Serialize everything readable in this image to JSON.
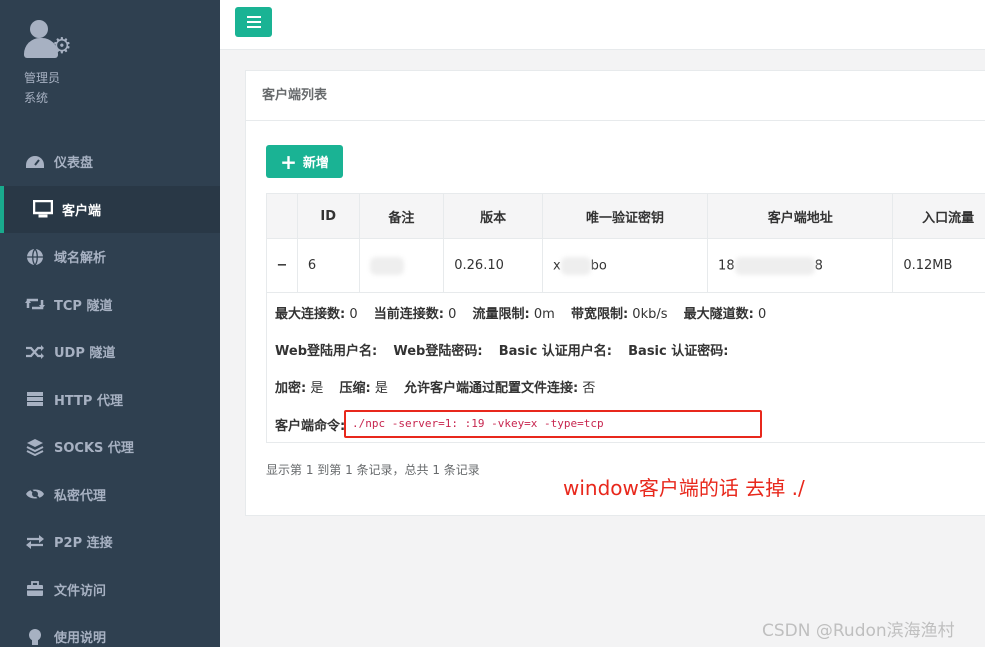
{
  "sidebar": {
    "user": {
      "name": "管理员",
      "role": "系统"
    },
    "items": [
      {
        "label": "仪表盘",
        "icon": "dashboard-icon"
      },
      {
        "label": "客户端",
        "icon": "desktop-icon",
        "active": true
      },
      {
        "label": "域名解析",
        "icon": "globe-icon"
      },
      {
        "label": "TCP 隧道",
        "icon": "retweet-icon"
      },
      {
        "label": "UDP 隧道",
        "icon": "random-icon"
      },
      {
        "label": "HTTP 代理",
        "icon": "server-icon"
      },
      {
        "label": "SOCKS 代理",
        "icon": "layers-icon"
      },
      {
        "label": "私密代理",
        "icon": "eye-slash-icon"
      },
      {
        "label": "P2P 连接",
        "icon": "exchange-icon"
      },
      {
        "label": "文件访问",
        "icon": "briefcase-icon"
      },
      {
        "label": "使用说明",
        "icon": "lightbulb-icon"
      }
    ]
  },
  "panel": {
    "title": "客户端列表",
    "add_button": "新增",
    "table": {
      "headers": [
        "ID",
        "备注",
        "版本",
        "唯一验证密钥",
        "客户端地址",
        "入口流量"
      ],
      "row": {
        "id": "6",
        "version": "0.26.10",
        "key_prefix": "x",
        "key_suffix": "bo",
        "addr_prefix": "18",
        "addr_suffix": "8",
        "inlet_flow": "0.12MB"
      }
    },
    "detail": {
      "max_conn_label": "最大连接数:",
      "max_conn": "0",
      "now_conn_label": "当前连接数:",
      "now_conn": "0",
      "flow_limit_label": "流量限制:",
      "flow_limit": "0m",
      "rate_limit_label": "带宽限制:",
      "rate_limit": "0kb/s",
      "max_tunnel_label": "最大隧道数:",
      "max_tunnel": "0",
      "web_user_label": "Web登陆用户名:",
      "web_pass_label": "Web登陆密码:",
      "basic_user_label": "Basic 认证用户名:",
      "basic_pass_label": "Basic 认证密码:",
      "crypt_label": "加密:",
      "crypt": "是",
      "compress_label": "压缩:",
      "compress": "是",
      "config_conn_label": "允许客户端通过配置文件连接:",
      "config_conn": "否",
      "command_label": "客户端命令:",
      "command": "./npc -server=1:         :19   -vkey=x      -type=tcp"
    },
    "pagination": "显示第 1 到第 1 条记录，总共 1 条记录"
  },
  "annotation": "window客户端的话 去掉 ./",
  "watermark": "CSDN @Rudon滨海渔村",
  "colors": {
    "sidebar": "#2f4050",
    "accent": "#1ab394",
    "highlight": "#e8281c"
  }
}
